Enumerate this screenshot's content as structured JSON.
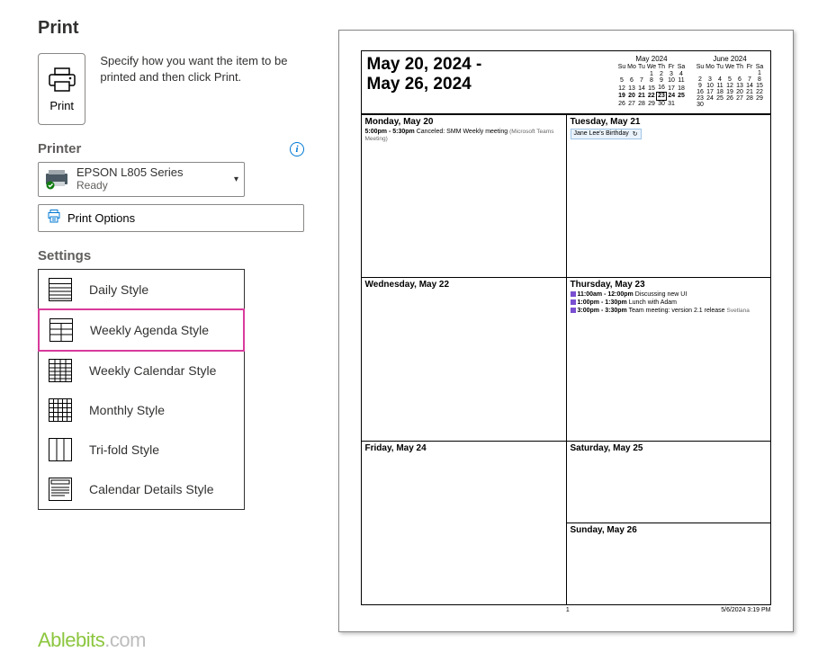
{
  "title": "Print",
  "info_text": "Specify how you want the item to be printed and then click Print.",
  "print_button_label": "Print",
  "printer_section": "Printer",
  "printer": {
    "name": "EPSON L805 Series",
    "status": "Ready"
  },
  "print_options_label": "Print Options",
  "settings_label": "Settings",
  "styles": [
    {
      "label": "Daily Style"
    },
    {
      "label": "Weekly Agenda Style"
    },
    {
      "label": "Weekly Calendar Style"
    },
    {
      "label": "Monthly Style"
    },
    {
      "label": "Tri-fold Style"
    },
    {
      "label": "Calendar Details Style"
    }
  ],
  "selected_style_index": 1,
  "watermark": {
    "a": "Ablebits",
    "b": ".com"
  },
  "preview": {
    "range_line1": "May 20, 2024 -",
    "range_line2": "May 26, 2024",
    "mini_may": {
      "caption": "May 2024",
      "heads": [
        "Su",
        "Mo",
        "Tu",
        "We",
        "Th",
        "Fr",
        "Sa"
      ],
      "rows": [
        [
          "",
          "",
          "",
          "1",
          "2",
          "3",
          "4"
        ],
        [
          "5",
          "6",
          "7",
          "8",
          "9",
          "10",
          "11"
        ],
        [
          "12",
          "13",
          "14",
          "15",
          "16",
          "17",
          "18"
        ],
        [
          "19",
          "20",
          "21",
          "22",
          "23",
          "24",
          "25"
        ],
        [
          "26",
          "27",
          "28",
          "29",
          "30",
          "31",
          ""
        ]
      ],
      "bold_row": 3,
      "today": "23"
    },
    "mini_jun": {
      "caption": "June 2024",
      "heads": [
        "Su",
        "Mo",
        "Tu",
        "We",
        "Th",
        "Fr",
        "Sa"
      ],
      "rows": [
        [
          "",
          "",
          "",
          "",
          "",
          "",
          "1"
        ],
        [
          "2",
          "3",
          "4",
          "5",
          "6",
          "7",
          "8"
        ],
        [
          "9",
          "10",
          "11",
          "12",
          "13",
          "14",
          "15"
        ],
        [
          "16",
          "17",
          "18",
          "19",
          "20",
          "21",
          "22"
        ],
        [
          "23",
          "24",
          "25",
          "26",
          "27",
          "28",
          "29"
        ],
        [
          "30",
          "",
          "",
          "",
          "",
          "",
          ""
        ]
      ]
    },
    "days": {
      "mon": {
        "title": "Monday, May 20",
        "ev_time": "5:00pm - 5:30pm",
        "ev_text": "Canceled: SMM Weekly meeting",
        "ev_sub": "(Microsoft Teams Meeting)"
      },
      "tue": {
        "title": "Tuesday, May 21",
        "allday": "Jane Lee's Birthday"
      },
      "wed": {
        "title": "Wednesday, May 22"
      },
      "thu": {
        "title": "Thursday, May 23",
        "e1_time": "11:00am - 12:00pm",
        "e1_text": "Discussing new UI",
        "e2_time": "1:00pm - 1:30pm",
        "e2_text": "Lunch with Adam",
        "e3_time": "3:00pm - 3:30pm",
        "e3_text": "Team meeting: version 2.1 release",
        "e3_sub": "Svetlana"
      },
      "fri": {
        "title": "Friday, May 24"
      },
      "sat": {
        "title": "Saturday, May 25"
      },
      "sun": {
        "title": "Sunday, May 26"
      }
    },
    "page_num": "1",
    "footer_ts": "5/6/2024 3:19 PM"
  }
}
